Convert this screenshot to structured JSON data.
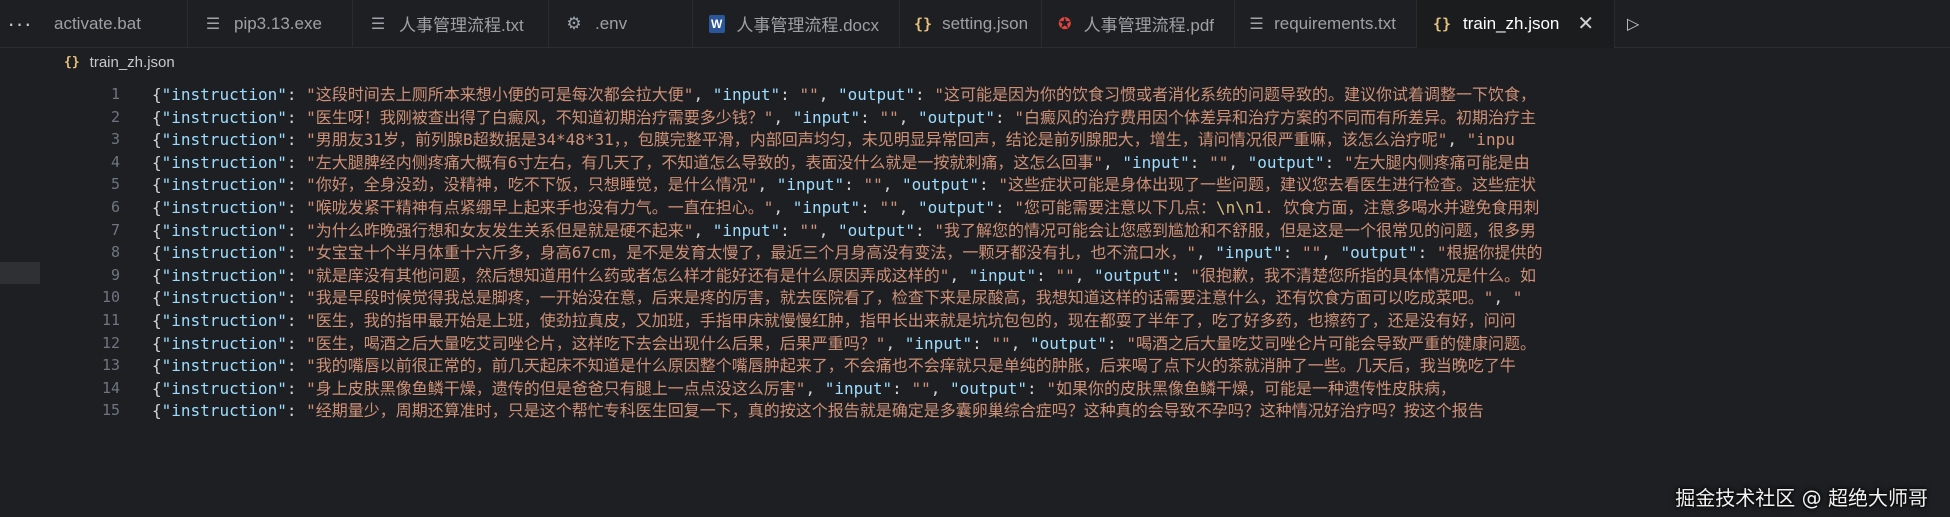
{
  "tabs": [
    {
      "label": "activate.bat",
      "icon": "none",
      "active": false
    },
    {
      "label": "pip3.13.exe",
      "icon": "lines-icon",
      "active": false
    },
    {
      "label": "人事管理流程.txt",
      "icon": "lines-icon",
      "active": false
    },
    {
      "label": ".env",
      "icon": "gear-icon",
      "active": false
    },
    {
      "label": "人事管理流程.docx",
      "icon": "word-icon",
      "active": false
    },
    {
      "label": "setting.json",
      "icon": "braces-icon",
      "active": false
    },
    {
      "label": "人事管理流程.pdf",
      "icon": "pdf-icon",
      "active": false
    },
    {
      "label": "requirements.txt",
      "icon": "lines-icon",
      "active": false
    },
    {
      "label": "train_zh.json",
      "icon": "braces-icon",
      "active": true
    }
  ],
  "overflow_glyph": "···",
  "close_glyph": "✕",
  "breadcrumb": {
    "file": "train_zh.json"
  },
  "lines": [
    {
      "n": "1",
      "text": "{\"instruction\": \"这段时间去上厕所本来想小便的可是每次都会拉大便\", \"input\": \"\", \"output\": \"这可能是因为你的饮食习惯或者消化系统的问题导致的。建议你试着调整一下饮食，"
    },
    {
      "n": "2",
      "text": "{\"instruction\": \"医生呀！我刚被查出得了白癜风，不知道初期治疗需要多少钱？\", \"input\": \"\", \"output\": \"白癜风的治疗费用因个体差异和治疗方案的不同而有所差异。初期治疗主"
    },
    {
      "n": "3",
      "text": "{\"instruction\": \"男朋友31岁，前列腺B超数据是34*48*31，，包膜完整平滑，内部回声均匀，未见明显异常回声，结论是前列腺肥大，增生，请问情况很严重嘛，该怎么治疗呢\", \"inpu"
    },
    {
      "n": "4",
      "text": "{\"instruction\": \"左大腿脾经内侧疼痛大概有6寸左右，有几天了，不知道怎么导致的，表面没什么就是一按就刺痛，这怎么回事\", \"input\": \"\", \"output\": \"左大腿内侧疼痛可能是由"
    },
    {
      "n": "5",
      "text": "{\"instruction\": \"你好，全身没劲，没精神，吃不下饭，只想睡觉，是什么情况\", \"input\": \"\", \"output\": \"这些症状可能是身体出现了一些问题，建议您去看医生进行检查。这些症状"
    },
    {
      "n": "6",
      "text": "{\"instruction\": \"喉咙发紧干精神有点紧绷早上起来手也没有力气。一直在担心。\", \"input\": \"\", \"output\": \"您可能需要注意以下几点：\\n\\n1. 饮食方面，注意多喝水并避免食用刺"
    },
    {
      "n": "7",
      "text": "{\"instruction\": \"为什么昨晚强行想和女友发生关系但是就是硬不起来\", \"input\": \"\", \"output\": \"我了解您的情况可能会让您感到尴尬和不舒服，但是这是一个很常见的问题，很多男"
    },
    {
      "n": "8",
      "text": "{\"instruction\": \"女宝宝十个半月体重十六斤多，身高67cm，是不是发育太慢了，最近三个月身高没有变法，一颗牙都没有扎，也不流口水，\", \"input\": \"\", \"output\": \"根据你提供的"
    },
    {
      "n": "9",
      "text": "{\"instruction\": \"就是庠没有其他问题，然后想知道用什么药或者怎么样才能好还有是什么原因弄成这样的\", \"input\": \"\", \"output\": \"很抱歉，我不清楚您所指的具体情况是什么。如"
    },
    {
      "n": "10",
      "text": "{\"instruction\": \"我是早段时候觉得我总是脚疼，一开始没在意，后来是疼的厉害，就去医院看了，检查下来是尿酸高，我想知道这样的话需要注意什么，还有饮食方面可以吃成菜吧。\", \""
    },
    {
      "n": "11",
      "text": "{\"instruction\": \"医生，我的指甲最开始是上班，使劲拉真皮，又加班，手指甲床就慢慢红肿，指甲长出来就是坑坑包包的，现在都耍了半年了，吃了好多药，也擦药了，还是没有好，问问"
    },
    {
      "n": "12",
      "text": "{\"instruction\": \"医生，喝酒之后大量吃艾司唑仑片，这样吃下去会出现什么后果，后果严重吗？\", \"input\": \"\", \"output\": \"喝酒之后大量吃艾司唑仑片可能会导致严重的健康问题。"
    },
    {
      "n": "13",
      "text": "{\"instruction\": \"我的嘴唇以前很正常的，前几天起床不知道是什么原因整个嘴唇肿起来了，不会痛也不会痒就只是单纯的肿胀，后来喝了点下火的茶就消肿了一些。几天后，我当晚吃了牛"
    },
    {
      "n": "14",
      "text": "{\"instruction\": \"身上皮肤黑像鱼鳞干燥，遗传的但是爸爸只有腿上一点点没这么厉害\", \"input\": \"\", \"output\": \"如果你的皮肤黑像鱼鳞干燥，可能是一种遗传性皮肤病，"
    },
    {
      "n": "15",
      "text": "{\"instruction\": \"经期量少，周期还算准时，只是这个帮忙专科医生回复一下，真的按这个报告就是确定是多囊卵巢综合症吗？这种真的会导致不孕吗？这种情况好治疗吗？按这个报告"
    }
  ],
  "watermark": "掘金技术社区 @ 超绝大师哥"
}
